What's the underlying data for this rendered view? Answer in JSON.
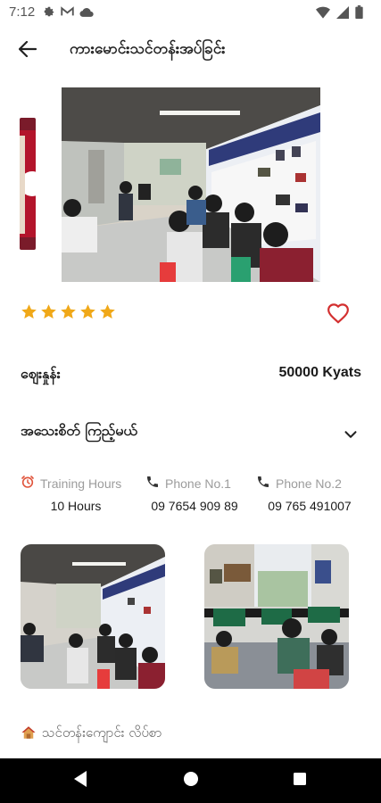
{
  "status_bar": {
    "time": "7:12"
  },
  "app_bar": {
    "title": "ကားမောင်းသင်တန်းအပ်ခြင်း"
  },
  "rating": {
    "stars": 5,
    "max": 5,
    "star_color": "#f0a818"
  },
  "favorite": {
    "color": "#d32f2f"
  },
  "price": {
    "label": "ဈေးနှုန်း",
    "value": "50000 Kyats"
  },
  "details": {
    "label": "အသေးစိတ် ကြည့်မယ်"
  },
  "info": {
    "training_hours": {
      "label": "Training Hours",
      "value": "10 Hours",
      "icon": "alarm-clock-icon"
    },
    "phone1": {
      "label": "Phone No.1",
      "value": "09 7654 909 89",
      "icon": "phone-icon"
    },
    "phone2": {
      "label": "Phone No.2",
      "value": "09 765 491007",
      "icon": "phone-icon"
    }
  },
  "syllabus": {
    "label": "သင်တန်းကျောင်း လိပ်စာ",
    "icon": "house-icon"
  },
  "icons": {
    "back": "arrow-left-icon",
    "heart": "heart-outline-icon",
    "chevron": "chevron-down-icon"
  }
}
